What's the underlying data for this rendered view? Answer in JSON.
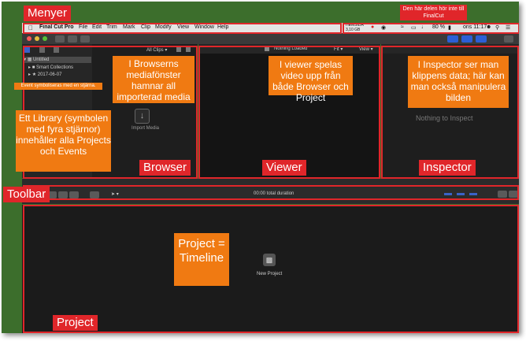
{
  "menubar": {
    "apple": "",
    "app_name": "Final Cut Pro",
    "items": [
      "File",
      "Edit",
      "Trim",
      "Mark",
      "Clip",
      "Modify",
      "View",
      "Window",
      "Help"
    ],
    "storage_label": "HEMSIDA",
    "storage_value": "3,10 GB",
    "battery": "80 %",
    "clock": "ons 11:17"
  },
  "browser": {
    "filter": "All Clips",
    "library": "Untitled",
    "smart_collections": "Smart Collections",
    "event": "2017-06-07",
    "import_label": "Import Media"
  },
  "viewer": {
    "status": "Nothing Loaded",
    "fit": "Fit",
    "view": "View"
  },
  "inspector": {
    "empty": "Nothing to Inspect"
  },
  "timeline": {
    "duration": "00:00 total duration",
    "new_project": "New Project"
  },
  "annotations": {
    "menyer": "Menyer",
    "not_fcp": "Den här delen hör inte till FinalCut",
    "browser_media": "I Browserns mediafönster hamnar all importerad media",
    "event_symbol": "Event symboliseras med en stjärna.",
    "library_info": "Ett Library (symbolen med fyra stjärnor) innehåller alla Projects och Events",
    "browser": "Browser",
    "viewer_info": "I viewer spelas video upp från både Browser och Project",
    "viewer": "Viewer",
    "inspector_info": "I Inspector ser man klippens data; här kan man också manipulera bilden",
    "inspector": "Inspector",
    "toolbar": "Toolbar",
    "project_info": "Project = Timeline",
    "project": "Project"
  },
  "colors": {
    "annotation_red": "#e0262a",
    "annotation_orange": "#f07a12",
    "desktop_green": "#3c6e2c",
    "selection_blue": "#2c5fd6"
  }
}
